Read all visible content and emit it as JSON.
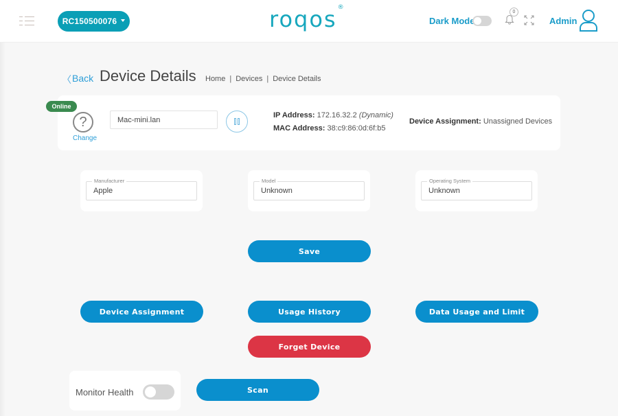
{
  "topbar": {
    "router_id": "RC150500076",
    "logo_text": "roqos",
    "logo_mark": "®",
    "dark_mode_label": "Dark Mode",
    "dark_mode_on": false,
    "notification_count": "0",
    "admin_label": "Admin"
  },
  "header": {
    "back_label": "Back",
    "title": "Device Details",
    "breadcrumb": [
      "Home",
      "Devices",
      "Device Details"
    ]
  },
  "device": {
    "status": "Online",
    "change_label": "Change",
    "name": "Mac-mini.lan",
    "ip_label": "IP Address:",
    "ip_value": "172.16.32.2",
    "ip_type": "(Dynamic)",
    "mac_label": "MAC Address:",
    "mac_value": "38:c9:86:0d:6f:b5",
    "assignment_label": "Device Assignment:",
    "assignment_value": "Unassigned Devices"
  },
  "fields": [
    {
      "label": "Manufacturer",
      "value": "Apple"
    },
    {
      "label": "Model",
      "value": "Unknown"
    },
    {
      "label": "Operating System",
      "value": "Unknown"
    }
  ],
  "actions": {
    "save": "Save",
    "device_assignment": "Device Assignment",
    "usage_history": "Usage History",
    "data_usage": "Data Usage and Limit",
    "forget_device": "Forget Device",
    "scan": "Scan"
  },
  "monitor": {
    "label": "Monitor Health",
    "enabled": false
  },
  "colors": {
    "brand": "#17a7bd",
    "primary": "#0a8fcd",
    "danger": "#dc3545",
    "online": "#3a8a4f"
  }
}
